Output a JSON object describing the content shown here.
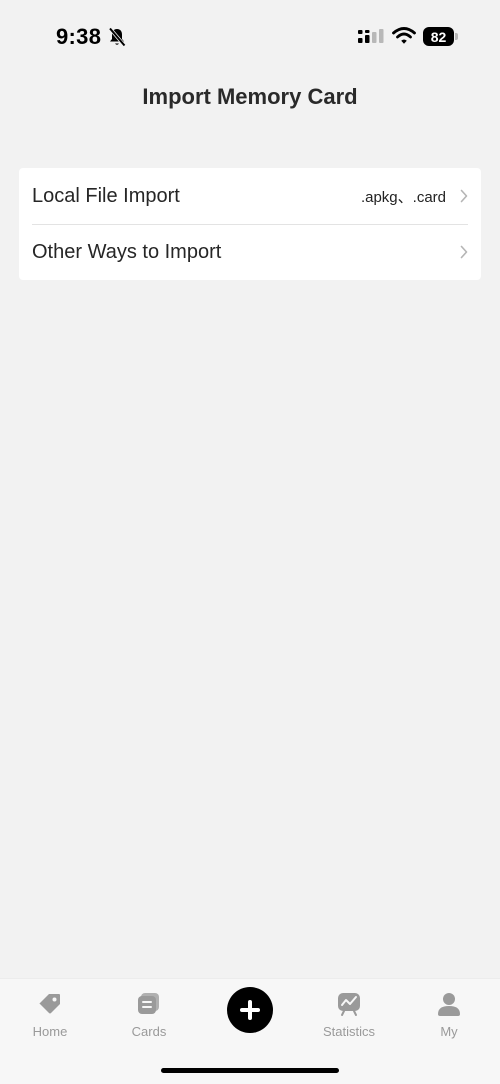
{
  "status_bar": {
    "time": "9:38",
    "battery": "82"
  },
  "page": {
    "title": "Import Memory Card"
  },
  "import_options": [
    {
      "label": "Local File Import",
      "value": ".apkg、.card"
    },
    {
      "label": "Other Ways to Import",
      "value": ""
    }
  ],
  "tab_bar": {
    "items": [
      {
        "label": "Home",
        "icon": "tag-icon"
      },
      {
        "label": "Cards",
        "icon": "cards-icon"
      },
      {
        "label": "",
        "icon": "plus-icon"
      },
      {
        "label": "Statistics",
        "icon": "chart-icon"
      },
      {
        "label": "My",
        "icon": "person-icon"
      }
    ]
  },
  "colors": {
    "background": "#f2f2f2",
    "card": "#ffffff",
    "tab_inactive": "#9a9a9a",
    "accent": "#000000"
  }
}
